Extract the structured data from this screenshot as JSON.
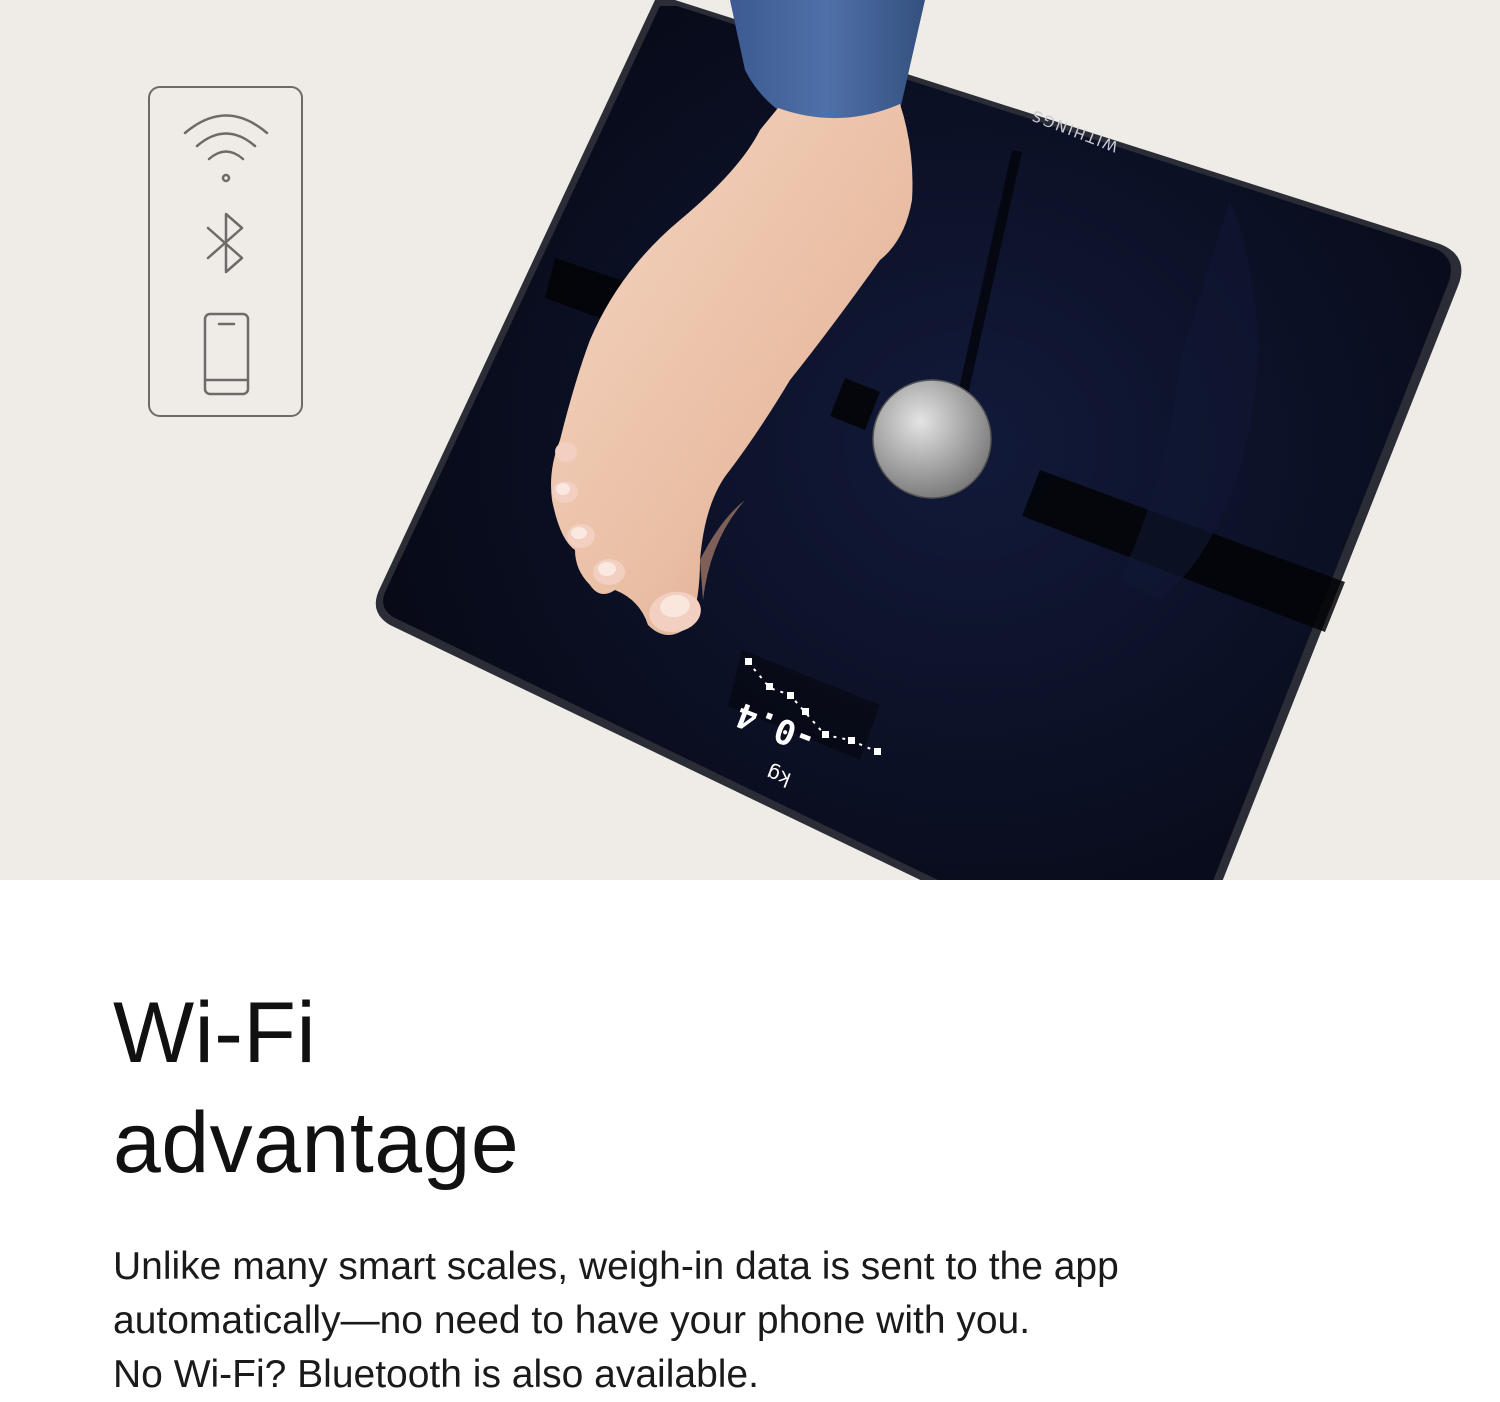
{
  "product": {
    "brand_label": "WITHINGS",
    "display_reading": "-0.4",
    "display_unit": "kg"
  },
  "connectivity": {
    "icons": [
      "wifi-icon",
      "bluetooth-icon",
      "smartphone-icon"
    ]
  },
  "headline": {
    "line1": "Wi-Fi",
    "line2": "advantage"
  },
  "body": {
    "line1": "Unlike many smart scales, weigh-in data is sent to the app",
    "line2": "automatically—no need to have your phone with you.",
    "line3": "No Wi-Fi? Bluetooth is also available."
  },
  "colors": {
    "hero_background": "#efece8",
    "scale_glass": "#0a0d1c",
    "text": "#111111"
  }
}
